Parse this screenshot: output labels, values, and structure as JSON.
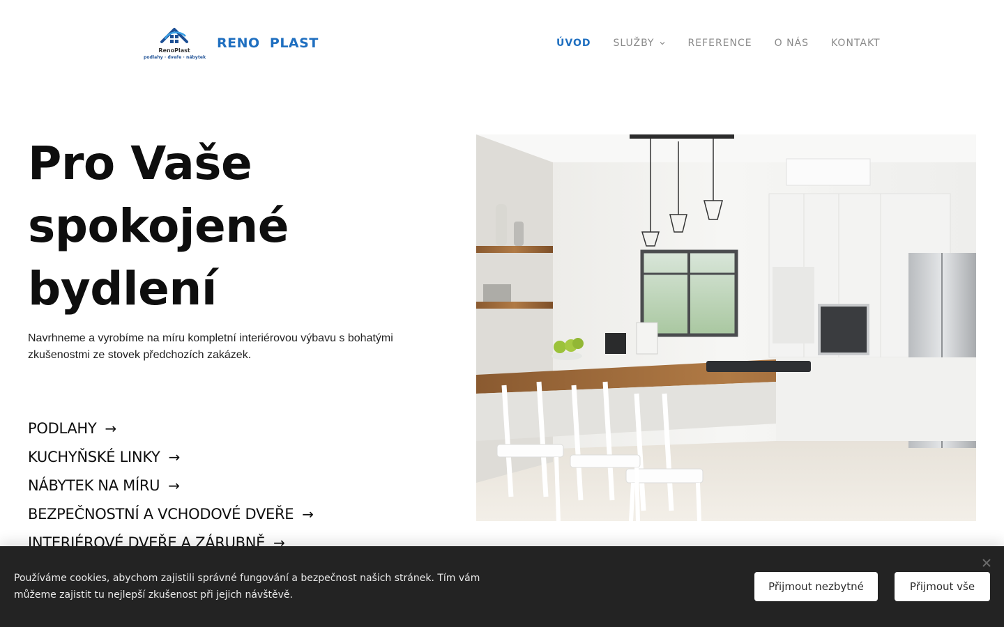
{
  "header": {
    "logo": {
      "name_small": "RenoPlast",
      "tagline": "podlahy · dveře · nábytek"
    },
    "brand_name": "RENO  PLAST",
    "nav": [
      {
        "label": "ÚVOD",
        "active": true
      },
      {
        "label": "SLUŽBY",
        "has_dropdown": true
      },
      {
        "label": "REFERENCE"
      },
      {
        "label": "O NÁS"
      },
      {
        "label": "KONTAKT"
      }
    ]
  },
  "hero": {
    "title_lines": [
      "Pro Vaše",
      "spokojené",
      "bydlení"
    ],
    "lead": "Navrhneme a vyrobíme na míru kompletní interiérovou výbavu s bohatými zkušenostmi ze stovek předchozích zakázek.",
    "services": [
      {
        "label": "PODLAHY",
        "arrow": "→"
      },
      {
        "label": "KUCHYŇSKÉ LINKY",
        "arrow": "→"
      },
      {
        "label": "NÁBYTEK NA MÍRU",
        "arrow": "→"
      },
      {
        "label": "BEZPEČNOSTNÍ A VCHODOVÉ DVEŘE",
        "arrow": "→"
      },
      {
        "label": "INTERIÉROVÉ DVEŘE A ZÁRUBNĚ",
        "arrow": "→"
      }
    ]
  },
  "cookie_bar": {
    "text": "Používáme cookies, abychom zajistili správné fungování a bezpečnost našich stránek. Tím vám můžeme zajistit tu nejlepší zkušenost při jejich návštěvě.",
    "accept_necessary": "Přijmout nezbytné",
    "accept_all": "Přijmout vše"
  },
  "colors": {
    "brand_blue": "#1f6fc0",
    "nav_gray": "#8a8a8a",
    "cookie_bg": "#232323",
    "text_dark": "#0e0e0e"
  },
  "icons": {
    "logo": "house-logo-icon",
    "dropdown": "chevron-down-icon",
    "close": "close-icon",
    "service_arrow": "arrow-right-icon"
  }
}
